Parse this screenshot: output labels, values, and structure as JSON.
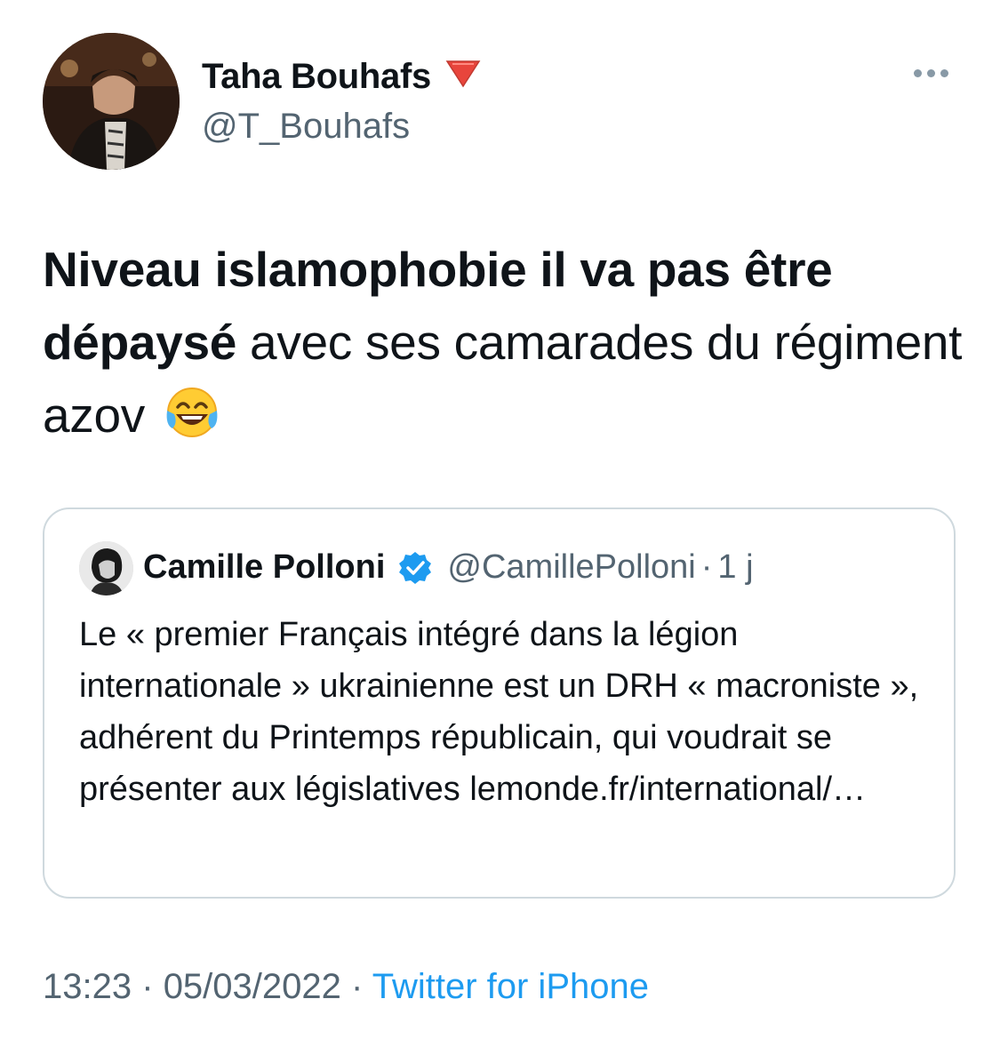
{
  "author": {
    "name": "Taha Bouhafs",
    "badge": "🔻",
    "handle": "@T_Bouhafs"
  },
  "tweet": {
    "text_bold": "Niveau islamophobie il va pas être dépaysé",
    "text_regular": " avec ses camarades du régiment azov",
    "emoji": "face-with-tears-of-joy"
  },
  "quoted": {
    "name": "Camille Polloni",
    "handle": "@CamillePolloni",
    "separator": "·",
    "time": "1 j",
    "text": "Le « premier Français intégré dans la légion internationale » ukrainienne est un DRH « macroniste », adhérent du Printemps républicain, qui voudrait se présenter aux législatives  lemonde.fr/international/…"
  },
  "meta": {
    "time": "13:23",
    "separator": "·",
    "date": "05/03/2022",
    "separator2": "·",
    "source": "Twitter for iPhone"
  },
  "colors": {
    "text": "#0f1419",
    "secondary": "#536471",
    "link": "#1d9bf0",
    "border": "#cfd9de",
    "verified": "#1d9bf0"
  }
}
